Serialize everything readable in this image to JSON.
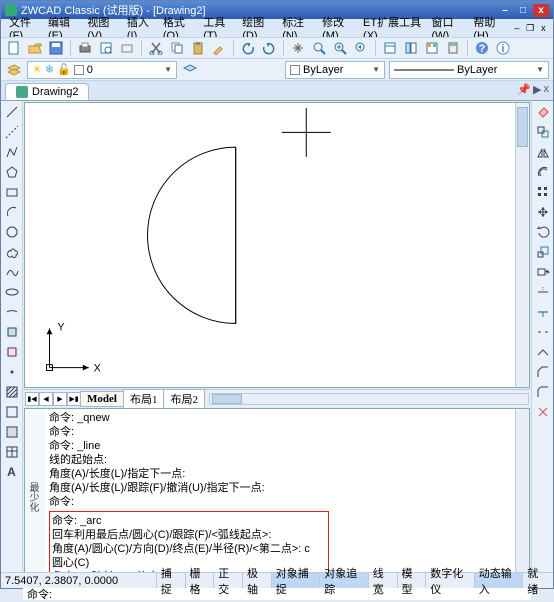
{
  "title": "ZWCAD Classic (试用版) - [Drawing2]",
  "menus": [
    "文件(F)",
    "编辑(E)",
    "视图(V)",
    "插入(I)",
    "格式(O)",
    "工具(T)",
    "绘图(D)",
    "标注(N)",
    "修改(M)",
    "ET扩展工具(X)",
    "窗口(W)",
    "帮助(H)"
  ],
  "layer_current": "0",
  "prop_color_label": "ByLayer",
  "prop_linetype_label": "ByLayer",
  "doc_tab": "Drawing2",
  "model_tabs": {
    "model": "Model",
    "l1": "布局1",
    "l2": "布局2"
  },
  "cmd_side": "最少化",
  "cmd_lines": {
    "l1": "命令: _qnew",
    "l2": "命令:",
    "l3": "命令: _line",
    "l4": "线的起始点:",
    "l5": "角度(A)/长度(L)/指定下一点:",
    "l6": "角度(A)/长度(L)/跟踪(F)/撤消(U)/指定下一点:",
    "l7": "命令:",
    "h1": "命令: _arc",
    "h2": "回车利用最后点/圆心(C)/跟踪(F)/<弧线起点>:",
    "h3": "角度(A)/圆心(C)/方向(D)/终点(E)/半径(R)/<第二点>: c",
    "h4": "圆心(C)",
    "h5": "角度(A)/弦长(L)/<终点>:"
  },
  "cmd_prompt": "命令:",
  "coords": "7.5407, 2.3807, 0.0000",
  "status": [
    "捕捉",
    "栅格",
    "正交",
    "极轴",
    "对象捕捉",
    "对象追踪",
    "线宽",
    "模型",
    "数字化仪",
    "动态输入",
    "就绪"
  ],
  "status_on": [
    4,
    5,
    9
  ]
}
